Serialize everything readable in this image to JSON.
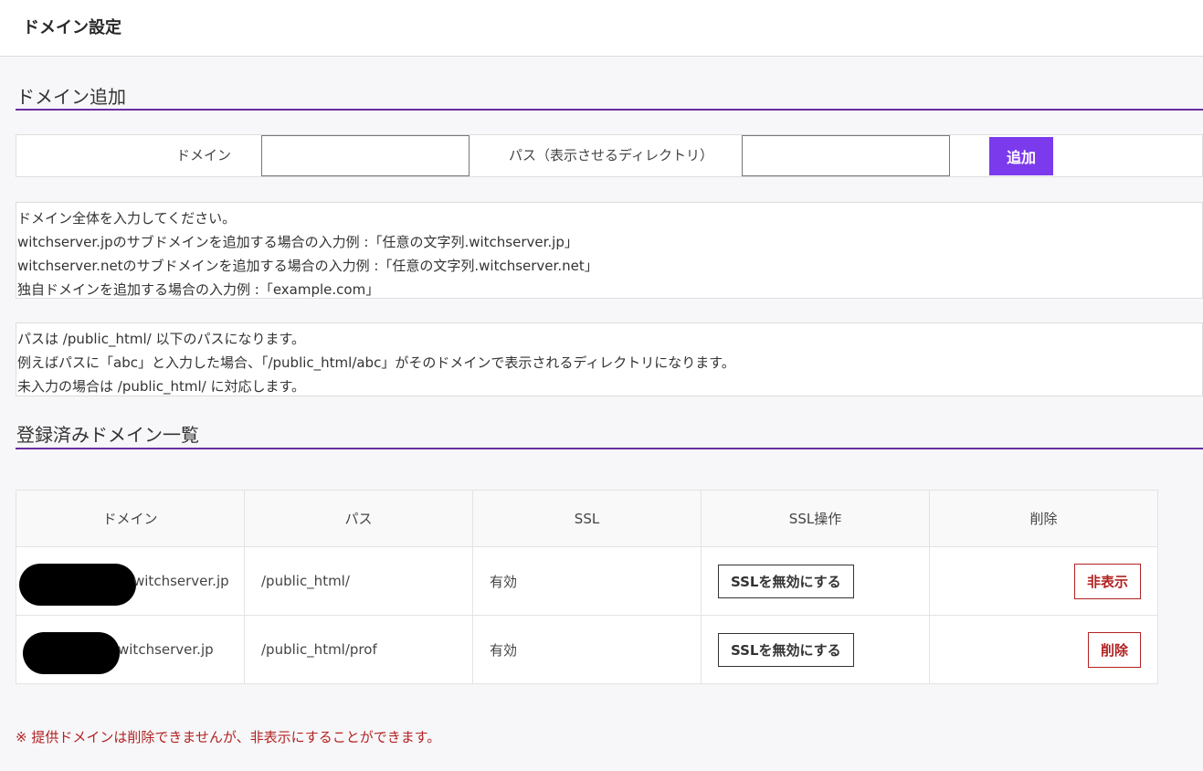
{
  "header": {
    "title": "ドメイン設定"
  },
  "add_section": {
    "heading": "ドメイン追加",
    "domain_label": "ドメイン",
    "domain_value": "",
    "path_label": "パス（表示させるディレクトリ）",
    "path_value": "",
    "add_button": "追加"
  },
  "notes": {
    "domain_help": [
      "ドメイン全体を入力してください。",
      "witchserver.jpのサブドメインを追加する場合の入力例 :「任意の文字列.witchserver.jp」",
      "witchserver.netのサブドメインを追加する場合の入力例 :「任意の文字列.witchserver.net」",
      "独自ドメインを追加する場合の入力例 :「example.com」"
    ],
    "path_help": [
      "パスは /public_html/ 以下のパスになります。",
      "例えばパスに「abc」と入力した場合、「/public_html/abc」がそのドメインで表示されるディレクトリになります。",
      "未入力の場合は /public_html/ に対応します。"
    ]
  },
  "list_section": {
    "heading": "登録済みドメイン一覧",
    "columns": [
      "ドメイン",
      "パス",
      "SSL",
      "SSL操作",
      "削除"
    ],
    "rows": [
      {
        "domain": "witchserver.jp",
        "path": "/public_html/",
        "ssl": "有効",
        "ssl_action": "SSLを無効にする",
        "delete_action": "非表示"
      },
      {
        "domain": "witchserver.jp",
        "path": "/public_html/prof",
        "ssl": "有効",
        "ssl_action": "SSLを無効にする",
        "delete_action": "削除"
      }
    ]
  },
  "footnote": "※ 提供ドメインは削除できませんが、非表示にすることができます。",
  "colors": {
    "accent": "#7c3aed",
    "heading_rule": "#6a2ea0",
    "danger": "#b22222"
  }
}
